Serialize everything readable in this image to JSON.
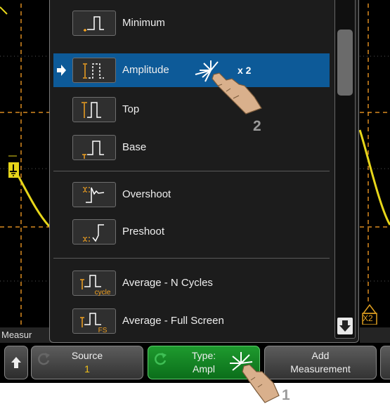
{
  "menu": {
    "items": [
      {
        "label": "Minimum",
        "icon": "minimum-icon",
        "selected": false
      },
      {
        "label": "Amplitude",
        "icon": "amplitude-icon",
        "selected": true,
        "annotation": "x 2"
      },
      {
        "label": "Top",
        "icon": "top-icon",
        "selected": false
      },
      {
        "label": "Base",
        "icon": "base-icon",
        "selected": false
      },
      {
        "label": "Overshoot",
        "icon": "overshoot-icon",
        "selected": false
      },
      {
        "label": "Preshoot",
        "icon": "preshoot-icon",
        "selected": false
      },
      {
        "label": "Average - N Cycles",
        "icon": "average-n-cycles-icon",
        "icon_caption": "cycle",
        "selected": false
      },
      {
        "label": "Average - Full Screen",
        "icon": "average-full-screen-icon",
        "icon_caption": "FS",
        "selected": false
      }
    ],
    "selected_marker": "arrow-right-icon"
  },
  "status_bar": {
    "left_text": "Measur",
    "x2_marker": "X2"
  },
  "softkeys": {
    "back_icon": "arrow-up-icon",
    "source": {
      "label": "Source",
      "value": "1"
    },
    "type": {
      "label": "Type:",
      "value": "Ampl"
    },
    "add": {
      "line1": "Add",
      "line2": "Measurement"
    }
  },
  "callouts": {
    "step1": "1",
    "step2": "2"
  },
  "colors": {
    "selected_row": "#0d5a98",
    "trace": "#e7d61a",
    "icon_orange": "#f0a020",
    "softkey_green": "#1e9a2e",
    "grid_dash": "#d98a20"
  }
}
